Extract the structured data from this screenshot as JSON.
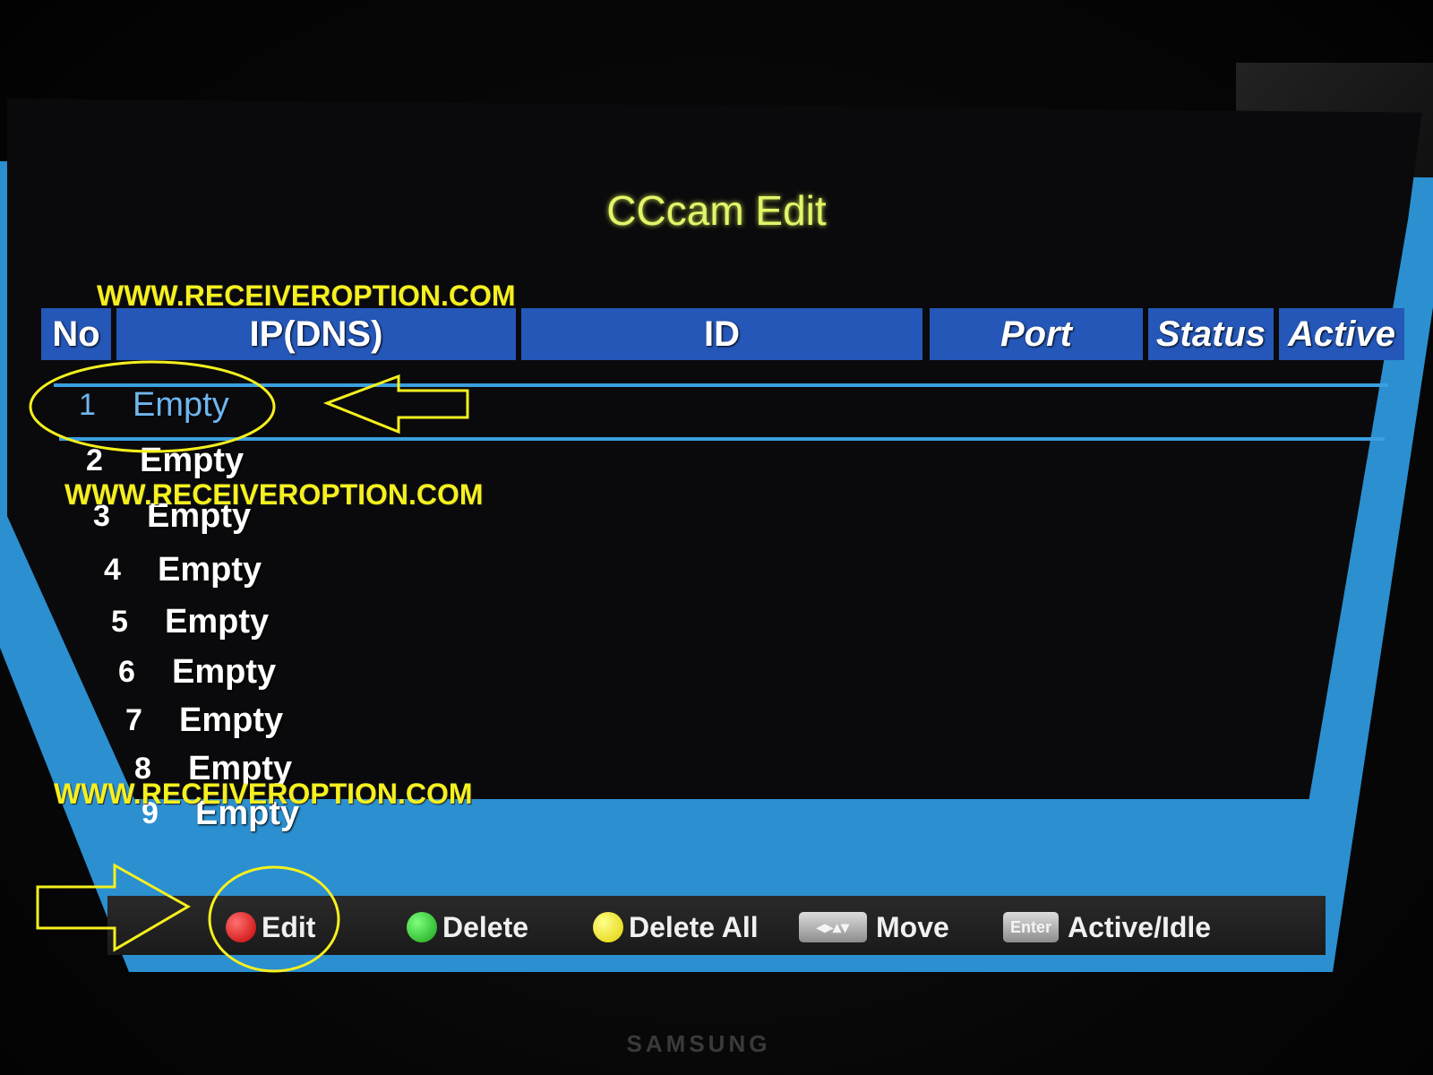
{
  "window": {
    "title": "CCcam Edit"
  },
  "table": {
    "headers": {
      "no": "No",
      "ip": "IP(DNS)",
      "id": "ID",
      "port": "Port",
      "status": "Status",
      "active": "Active"
    },
    "rows": [
      {
        "no": "1",
        "ip": "Empty",
        "selected": true
      },
      {
        "no": "2",
        "ip": "Empty"
      },
      {
        "no": "3",
        "ip": "Empty"
      },
      {
        "no": "4",
        "ip": "Empty"
      },
      {
        "no": "5",
        "ip": "Empty"
      },
      {
        "no": "6",
        "ip": "Empty"
      },
      {
        "no": "7",
        "ip": "Empty"
      },
      {
        "no": "8",
        "ip": "Empty"
      },
      {
        "no": "9",
        "ip": "Empty"
      }
    ]
  },
  "help_bar": {
    "edit": "Edit",
    "delete": "Delete",
    "delete_all": "Delete All",
    "move_key": "◂▸▴▾",
    "move": "Move",
    "enter_key": "Enter",
    "active_idle": "Active/Idle"
  },
  "watermarks": [
    "WWW.RECEIVEROPTION.COM",
    "WWW.RECEIVEROPTION.COM",
    "WWW.RECEIVEROPTION.COM"
  ],
  "bezel": {
    "brand": "SAMSUNG"
  },
  "colors": {
    "title": "#e4f56a",
    "frame": "#2b8fd0",
    "header": "#2457b8",
    "selected_text": "#6fb6ee",
    "watermark": "#f5f01e",
    "annotation": "#f5f01e"
  }
}
